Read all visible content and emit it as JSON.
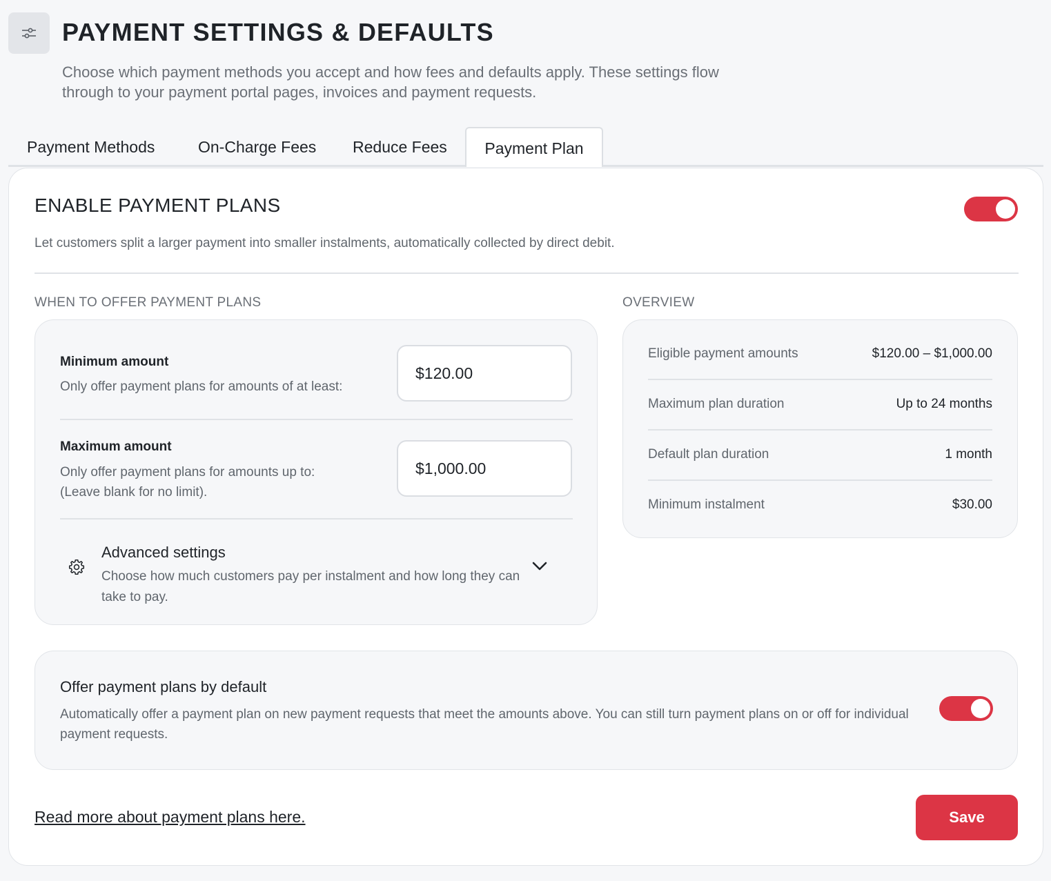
{
  "header": {
    "icon": "sliders-icon",
    "title": "PAYMENT SETTINGS & DEFAULTS",
    "subtitle": "Choose which payment methods you accept and how fees and defaults apply. These settings flow through to your payment portal pages, invoices and payment requests."
  },
  "tabs": [
    {
      "label": "Payment Methods",
      "active": false
    },
    {
      "label": "On-Charge Fees",
      "active": false
    },
    {
      "label": "Reduce Fees",
      "active": false
    },
    {
      "label": "Payment Plan",
      "active": true
    }
  ],
  "enable": {
    "title": "ENABLE PAYMENT PLANS",
    "description": "Let customers split a larger payment into smaller instalments, automatically collected by direct debit.",
    "toggle_on": true
  },
  "when": {
    "section_label": "WHEN TO OFFER PAYMENT PLANS",
    "minimum": {
      "label": "Minimum amount",
      "help": "Only offer payment plans for amounts of at least:",
      "value": "$120.00"
    },
    "maximum": {
      "label": "Maximum amount",
      "help_line1": "Only offer payment plans for amounts up to:",
      "help_line2": "(Leave blank for no limit).",
      "value": "$1,000.00"
    },
    "advanced": {
      "icon": "gear-icon",
      "title": "Advanced settings",
      "description": "Choose how much customers pay per instalment and how long they can take to pay.",
      "chevron": "chevron-down-icon"
    }
  },
  "overview": {
    "section_label": "OVERVIEW",
    "rows": [
      {
        "label": "Eligible payment amounts",
        "value": "$120.00 – $1,000.00"
      },
      {
        "label": "Maximum plan duration",
        "value": "Up to 24 months"
      },
      {
        "label": "Default plan duration",
        "value": "1 month"
      },
      {
        "label": "Minimum instalment",
        "value": "$30.00"
      }
    ]
  },
  "default_offer": {
    "title": "Offer payment plans by default",
    "description": "Automatically offer a payment plan on new payment requests that meet the amounts above. You can still turn payment plans on or off for individual payment requests.",
    "toggle_on": true
  },
  "footer": {
    "link": "Read more about payment plans here.",
    "save_label": "Save"
  },
  "colors": {
    "accent": "#dc3545",
    "background": "#f6f7f9",
    "card": "#ffffff"
  }
}
